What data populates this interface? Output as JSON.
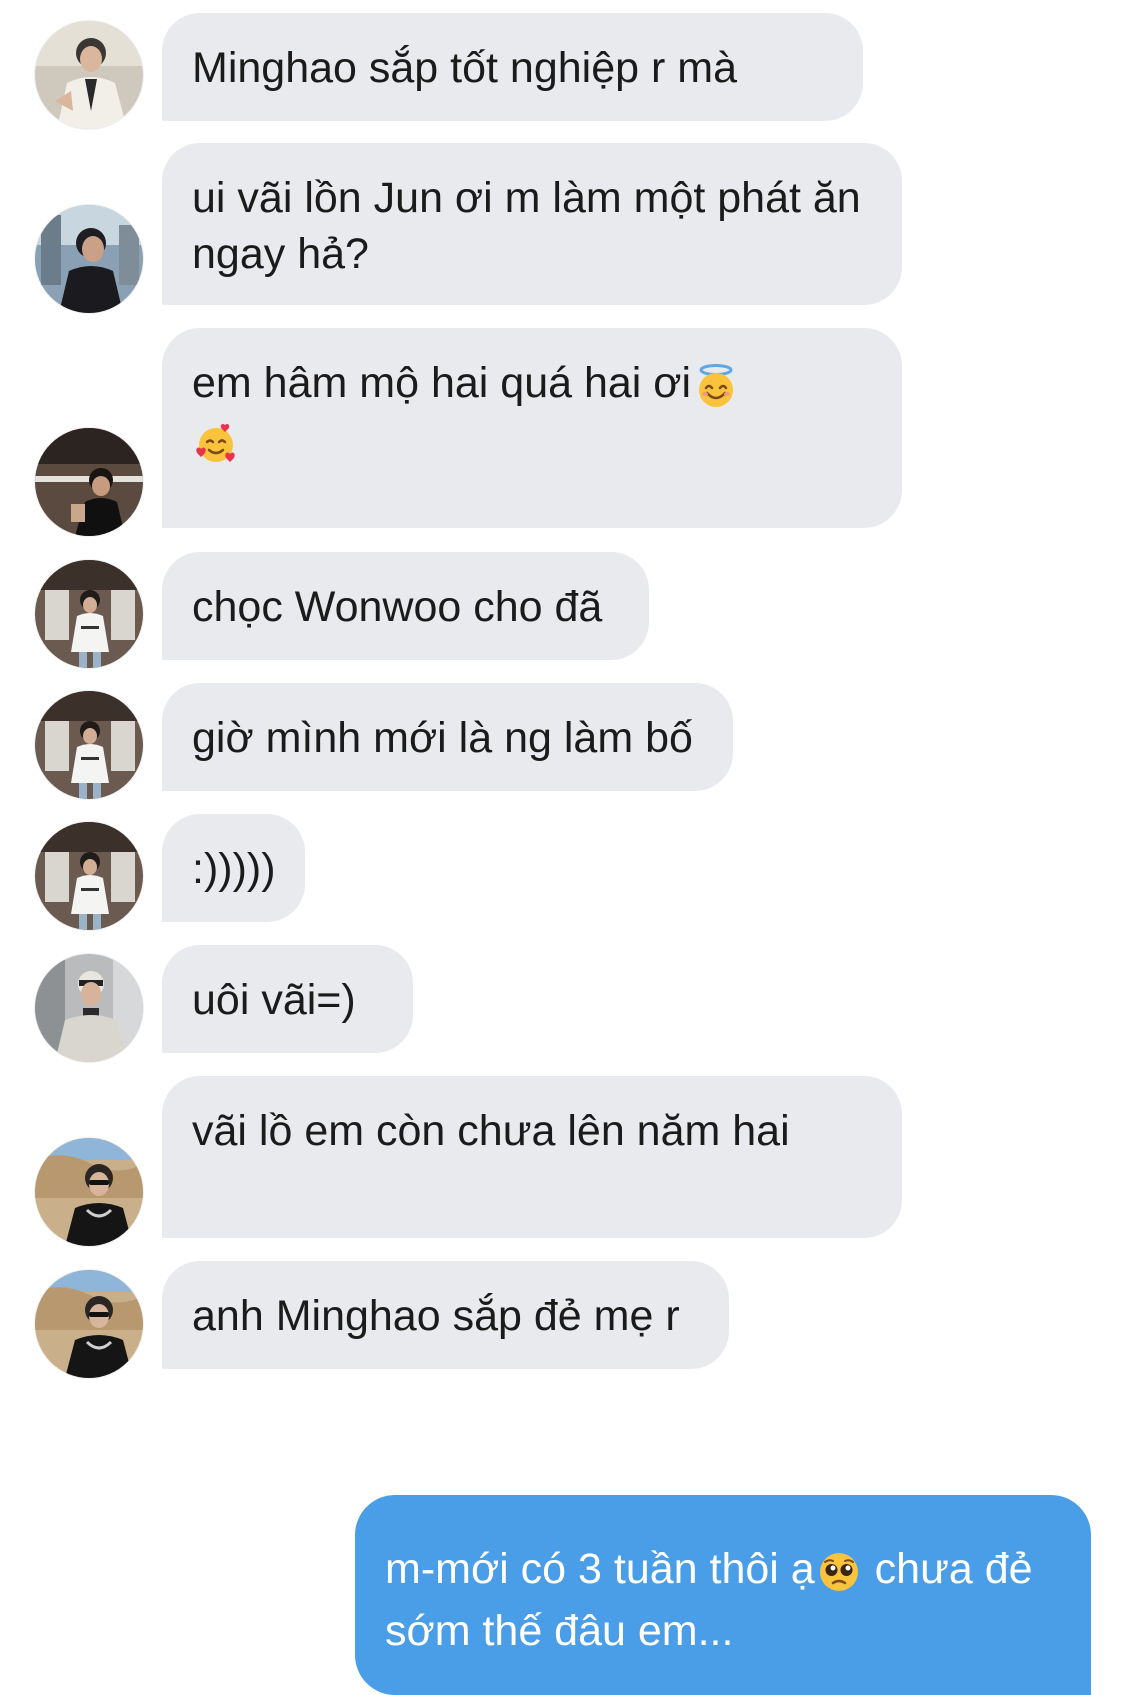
{
  "messages": [
    {
      "sender_avatar": "avatar-1",
      "text": "Minghao sắp tốt nghiệp r mà"
    },
    {
      "sender_avatar": "avatar-2",
      "text": "ui vãi lồn Jun ơi m làm một phát ăn ngay hả?"
    },
    {
      "sender_avatar": "avatar-3",
      "text": "em hâm mộ hai quá hai ơi",
      "emojis": [
        "smiling-face-with-halo-emoji",
        "smiling-face-with-hearts-emoji"
      ]
    },
    {
      "sender_avatar": "avatar-4",
      "text": "chọc Wonwoo cho đã"
    },
    {
      "sender_avatar": "avatar-4",
      "text": "giờ mình mới là ng làm bố"
    },
    {
      "sender_avatar": "avatar-4",
      "text": ":)))))"
    },
    {
      "sender_avatar": "avatar-5",
      "text": "uôi vãi=)"
    },
    {
      "sender_avatar": "avatar-6",
      "text": "vãi lồ em còn chưa lên năm hai"
    },
    {
      "sender_avatar": "avatar-6",
      "text": "anh Minghao sắp đẻ mẹ r"
    }
  ],
  "outgoing": {
    "text_before_emoji": "m-mới có 3 tuần thôi ạ",
    "emoji": "pleading-face-emoji",
    "text_after_emoji": " chưa đẻ sớm thế đâu em..."
  },
  "colors": {
    "incoming_bubble": "#e9eaee",
    "outgoing_bubble": "#4a9ee8",
    "incoming_text": "#1b1b1b",
    "outgoing_text": "#ffffff"
  }
}
